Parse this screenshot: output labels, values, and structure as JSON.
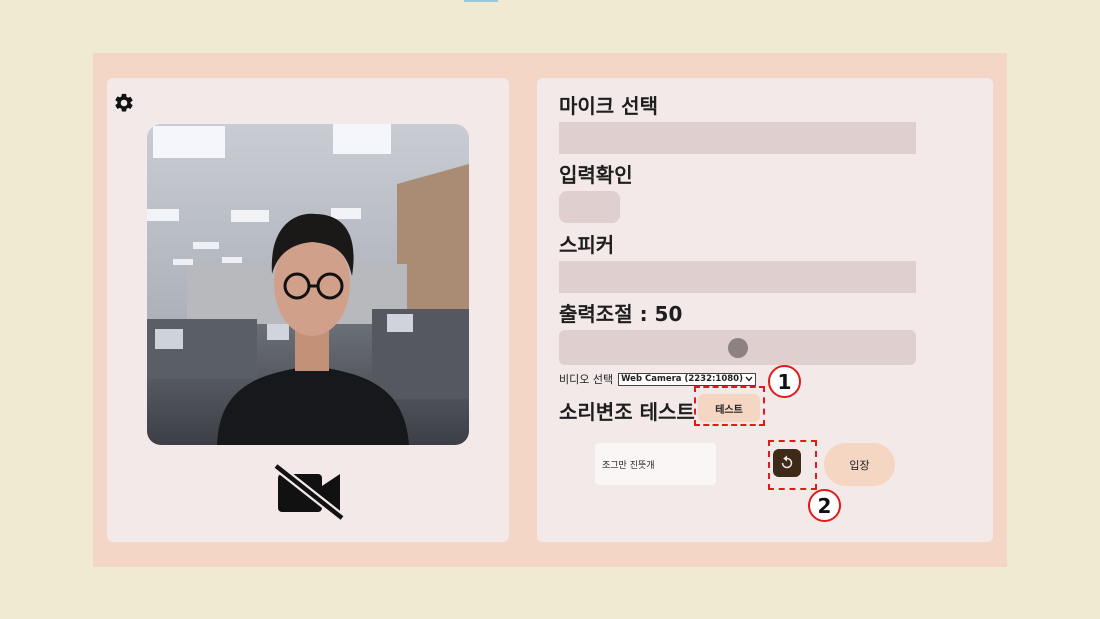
{
  "settings": {
    "icon": "gear-icon"
  },
  "camera": {
    "off_icon": "video-camera-off-icon"
  },
  "mic": {
    "label": "마이크 선택",
    "value": ""
  },
  "input_check": {
    "label": "입력확인"
  },
  "speaker": {
    "label": "스피커",
    "value": ""
  },
  "volume": {
    "label": "출력조절 : 50",
    "value_percent": 50
  },
  "video_select": {
    "label": "비디오 선택",
    "selected": "Web Camera (2232:1080)"
  },
  "voice_mod": {
    "label": "소리변조 테스트",
    "test_button": "테스트"
  },
  "message": {
    "value": "조그만 진뜻개"
  },
  "reset": {
    "icon": "reset-icon"
  },
  "enter": {
    "label": "입장"
  },
  "annotations": {
    "one": "1",
    "two": "2"
  },
  "colors": {
    "annotation": "#e21a1a",
    "accent": "#f4d6c2",
    "panel": "#f3e9e9",
    "frame": "#f3d6c6"
  }
}
